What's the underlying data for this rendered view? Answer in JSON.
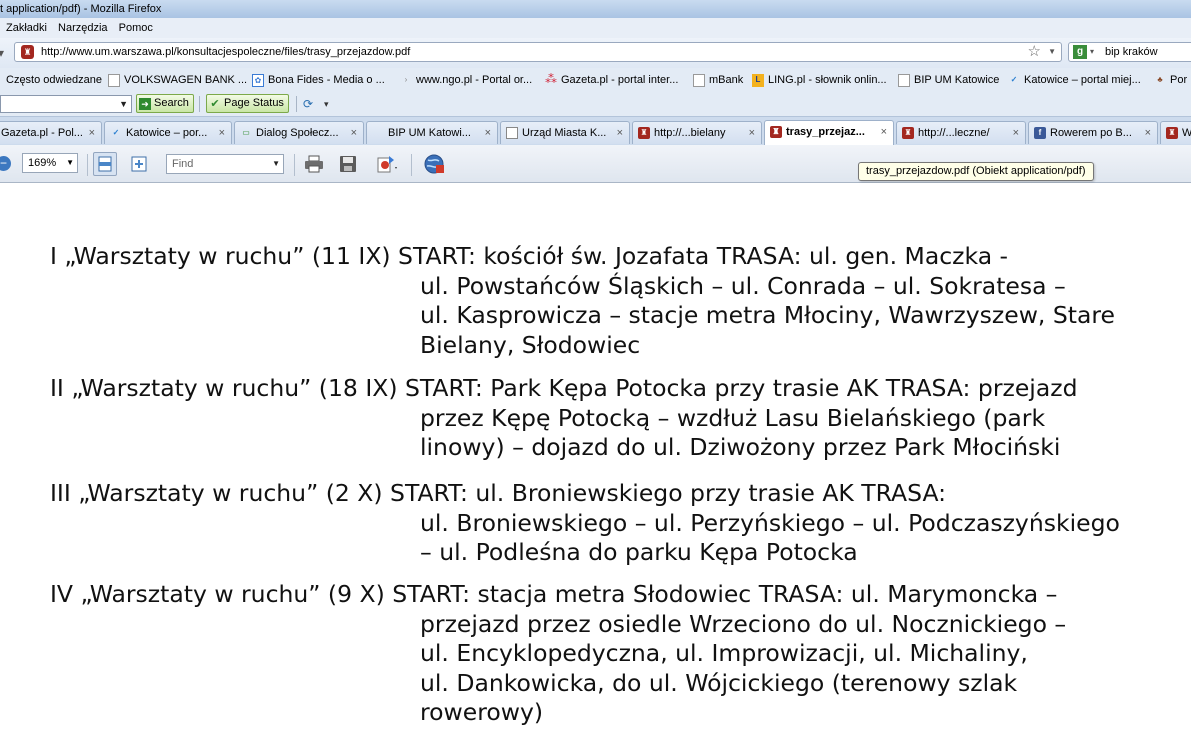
{
  "window": {
    "title": "t application/pdf) - Mozilla Firefox"
  },
  "menu": {
    "items": [
      "Zakładki",
      "Narzędzia",
      "Pomoc"
    ]
  },
  "nav": {
    "url": "http://www.um.warszawa.pl/konsultacjespoleczne/files/trasy_przejazdow.pdf",
    "search_engine_value": "bip kraków"
  },
  "bookmarks": [
    "Często odwiedzane",
    "VOLKSWAGEN BANK ...",
    "Bona Fides - Media o ...",
    "www.ngo.pl - Portal or...",
    "Gazeta.pl - portal inter...",
    "mBank",
    "LING.pl - słownik onlin...",
    "BIP UM Katowice",
    "Katowice – portal miej...",
    "Por"
  ],
  "toolbar": {
    "search_label": "Search",
    "page_status_label": "Page Status"
  },
  "tabs": [
    {
      "label": "Gazeta.pl - Pol..."
    },
    {
      "label": "Katowice – por..."
    },
    {
      "label": "Dialog Społecz..."
    },
    {
      "label": "BIP UM Katowi..."
    },
    {
      "label": "Urząd Miasta K..."
    },
    {
      "label": "http://...bielany"
    },
    {
      "label": "trasy_przejaz..."
    },
    {
      "label": "http://...leczne/"
    },
    {
      "label": "Rowerem po B..."
    },
    {
      "label": "W"
    }
  ],
  "tab_close_glyph": "×",
  "pdf_toolbar": {
    "zoom": "169%",
    "find_placeholder": "Find"
  },
  "tooltip": "trasy_przejazdow.pdf (Obiekt application/pdf)",
  "document": {
    "entries": [
      {
        "lines": [
          "I „Warsztaty w ruchu” (11 IX) START: kościół św. Jozafata TRASA: ul. gen. Maczka -",
          "ul. Powstańców Śląskich – ul. Conrada – ul. Sokratesa –",
          "ul. Kasprowicza – stacje metra Młociny, Wawrzyszew, Stare",
          "Bielany, Słodowiec"
        ]
      },
      {
        "lines": [
          "II „Warsztaty w ruchu” (18 IX) START: Park Kępa Potocka przy trasie AK TRASA: przejazd",
          "przez Kępę Potocką – wzdłuż Lasu Bielańskiego (park",
          "linowy) – dojazd do ul. Dziwożony przez Park Młociński"
        ]
      },
      {
        "lines": [
          "III „Warsztaty w ruchu” (2 X) START: ul. Broniewskiego przy trasie AK TRASA:",
          "ul. Broniewskiego – ul. Perzyńskiego – ul. Podczaszyńskiego",
          "– ul. Podleśna do parku Kępa Potocka"
        ]
      },
      {
        "lines": [
          "IV „Warsztaty w ruchu” (9 X) START: stacja metra Słodowiec TRASA: ul. Marymoncka –",
          "przejazd przez osiedle Wrzeciono do ul. Nocznickiego –",
          "ul. Encyklopedyczna, ul. Improwizacji, ul. Michaliny,",
          "ul. Dankowicka, do ul. Wójcickiego (terenowy szlak",
          "rowerowy)"
        ]
      }
    ]
  }
}
